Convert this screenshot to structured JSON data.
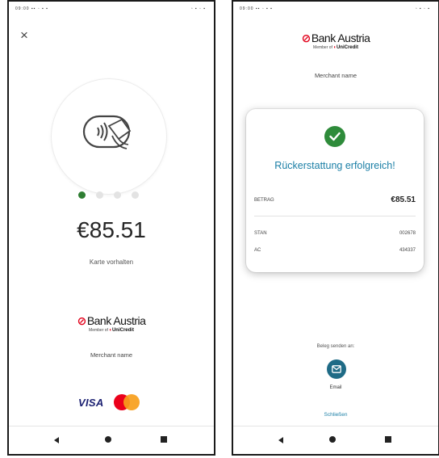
{
  "status_bar": {
    "left": "09:00 ▪▪ ◦ ▪ ▪",
    "right": "▫ ▪ ◦ ▪"
  },
  "screen1": {
    "close_icon": "×",
    "tap_icon": "contactless-card-icon",
    "dots_total": 4,
    "dots_active": 1,
    "amount": "€85.51",
    "hint": "Karte vorhalten",
    "bank_name": "Bank Austria",
    "bank_sub_prefix": "Member of",
    "bank_sub_brand": "UniCredit",
    "merchant": "Merchant name",
    "card_brands": {
      "visa": "VISA",
      "mastercard_icon": "mastercard-icon"
    }
  },
  "screen2": {
    "bank_name": "Bank Austria",
    "bank_sub_prefix": "Member of",
    "bank_sub_brand": "UniCredit",
    "merchant": "Merchant name",
    "success_text": "Rückerstattung erfolgreich!",
    "rows": {
      "amount": {
        "label": "BETRAG",
        "value": "€85.51"
      },
      "stan": {
        "label": "STAN",
        "value": "002678"
      },
      "ac": {
        "label": "AC",
        "value": "434337"
      }
    },
    "send_label": "Beleg senden an:",
    "email_label": "Email",
    "close_label": "Schließen"
  },
  "colors": {
    "accent_green": "#2e7d32",
    "accent_blue": "#1b7fa6",
    "brand_red": "#e2001a",
    "mail_button": "#1f6b86"
  }
}
